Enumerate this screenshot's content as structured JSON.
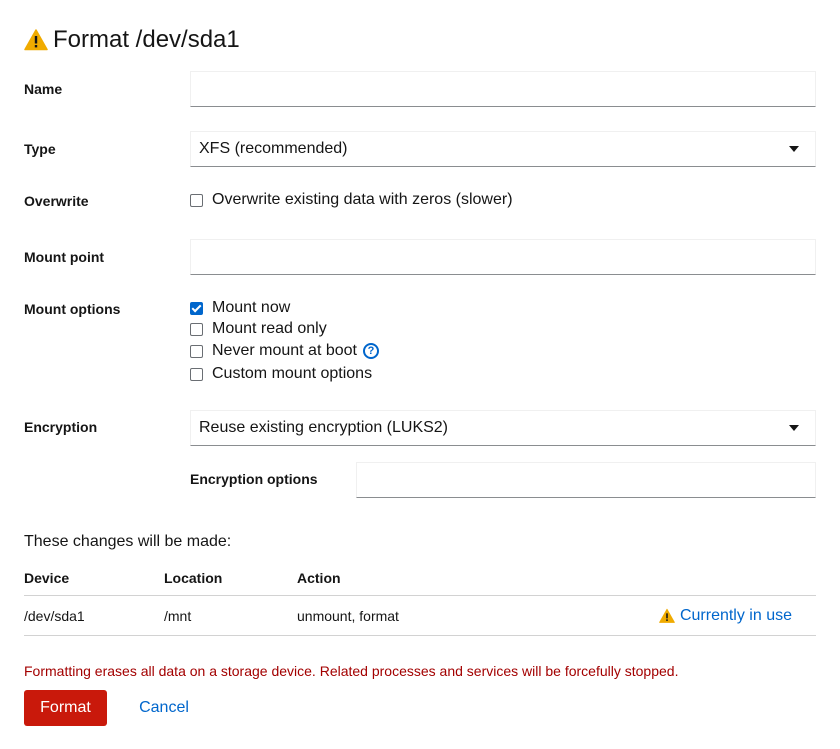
{
  "dialog": {
    "title": "Format /dev/sda1",
    "title_icon": "warning-triangle-icon"
  },
  "form": {
    "name": {
      "label": "Name",
      "value": "",
      "placeholder": ""
    },
    "type": {
      "label": "Type",
      "selected": "XFS (recommended)"
    },
    "overwrite": {
      "label": "Overwrite",
      "checkbox_label": "Overwrite existing data with zeros (slower)",
      "checked": false
    },
    "mount_point": {
      "label": "Mount point",
      "value": "",
      "placeholder": ""
    },
    "mount_options": {
      "label": "Mount options",
      "items": [
        {
          "label": "Mount now",
          "checked": true
        },
        {
          "label": "Mount read only",
          "checked": false
        },
        {
          "label": "Never mount at boot",
          "checked": false,
          "help_icon": "question-circle-icon"
        },
        {
          "label": "Custom mount options",
          "checked": false
        }
      ]
    },
    "encryption": {
      "label": "Encryption",
      "selected": "Reuse existing encryption (LUKS2)",
      "options_label": "Encryption options",
      "options_value": ""
    }
  },
  "changes": {
    "title": "These changes will be made:",
    "columns": [
      "Device",
      "Location",
      "Action"
    ],
    "rows": [
      {
        "device": "/dev/sda1",
        "location": "/mnt",
        "action": "unmount, format",
        "status": "Currently in use",
        "status_icon": "warning-triangle-icon"
      }
    ]
  },
  "warning": "Formatting erases all data on a storage device. Related processes and services will be forcefully stopped.",
  "footer": {
    "primary_label": "Format",
    "cancel_label": "Cancel"
  },
  "colors": {
    "danger": "#c9190b",
    "link": "#0066cc",
    "warning_icon": "#f0ab00",
    "warning_text": "#a30000"
  }
}
